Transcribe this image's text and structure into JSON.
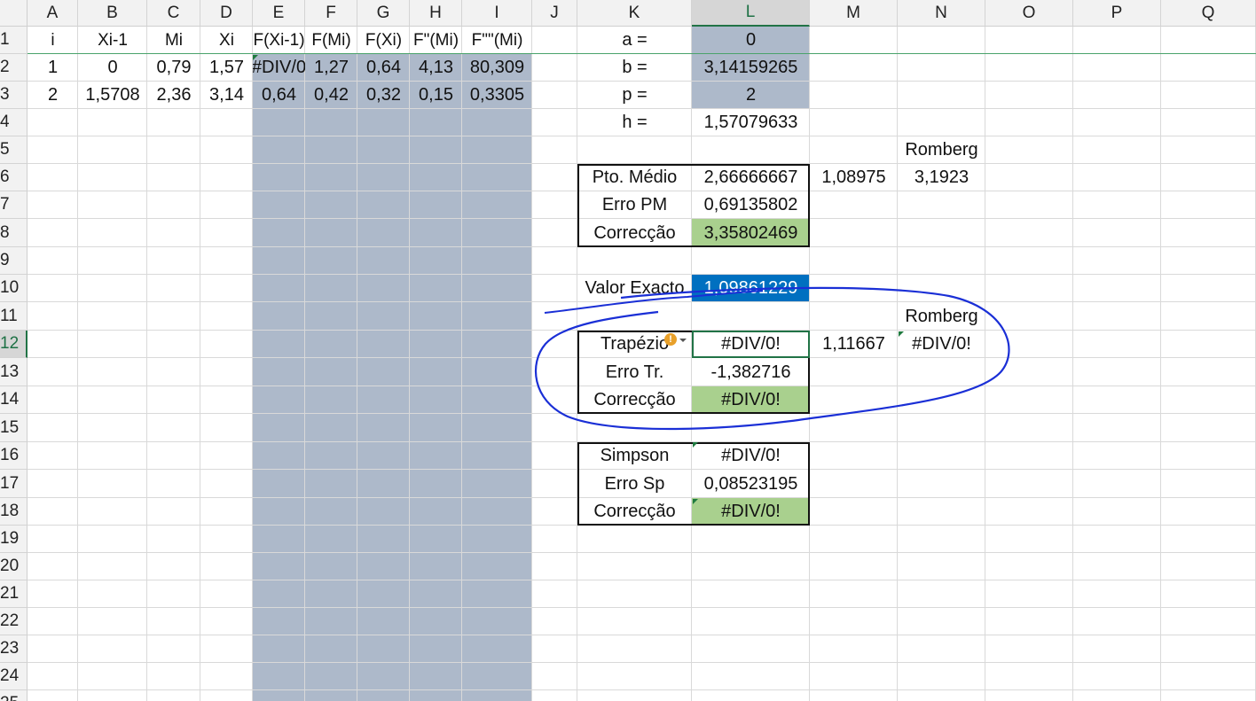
{
  "columns": [
    "A",
    "B",
    "C",
    "D",
    "E",
    "F",
    "G",
    "H",
    "I",
    "J",
    "K",
    "L",
    "M",
    "N",
    "O",
    "P",
    "Q"
  ],
  "rows": [
    "1",
    "2",
    "3",
    "4",
    "5",
    "6",
    "7",
    "8",
    "9",
    "10",
    "11",
    "12",
    "13",
    "14",
    "15",
    "16",
    "17",
    "18",
    "19",
    "20",
    "21",
    "22",
    "23",
    "24",
    "25"
  ],
  "selected_column": "L",
  "selected_row": "12",
  "header_row": [
    "i",
    "Xi-1",
    "Mi",
    "Xi",
    "F(Xi-1)",
    "F(Mi)",
    "F(Xi)",
    "F\"(Mi)",
    "F\"\"(Mi)"
  ],
  "data_rows": [
    [
      "1",
      "0",
      "0,79",
      "1,57",
      "#DIV/0",
      "1,27",
      "0,64",
      "4,13",
      "80,309"
    ],
    [
      "2",
      "1,5708",
      "2,36",
      "3,14",
      "0,64",
      "0,42",
      "0,32",
      "0,15",
      "0,3305"
    ]
  ],
  "params": [
    {
      "label": "a =",
      "value": "0"
    },
    {
      "label": "b =",
      "value": "3,14159265"
    },
    {
      "label": "p =",
      "value": "2"
    },
    {
      "label": "h =",
      "value": "1,57079633"
    }
  ],
  "romberg_label": "Romberg",
  "ponto_medio": {
    "rows": [
      {
        "label": "Pto. Médio",
        "value": "2,66666667"
      },
      {
        "label": "Erro PM",
        "value": "0,69135802"
      },
      {
        "label": "Correcção",
        "value": "3,35802469"
      }
    ],
    "m_value": "1,08975",
    "romberg_value": "3,1923"
  },
  "valor_exacto": {
    "label": "Valor Exacto",
    "value": "1,09861229"
  },
  "trapezio": {
    "rows": [
      {
        "label": "Trapézio",
        "value": "#DIV/0!"
      },
      {
        "label": "Erro Tr.",
        "value": "-1,382716"
      },
      {
        "label": "Correcção",
        "value": "#DIV/0!"
      }
    ],
    "m_value": "1,11667",
    "romberg_value": "#DIV/0!",
    "warning_glyph": "!"
  },
  "simpson": {
    "rows": [
      {
        "label": "Simpson",
        "value": "#DIV/0!"
      },
      {
        "label": "Erro Sp",
        "value": "0,08523195"
      },
      {
        "label": "Correcção",
        "value": "#DIV/0!"
      }
    ]
  },
  "colors": {
    "header_bg": "#f2f2f2",
    "input_fill": "#adb9ca",
    "correction_fill": "#a9d08e",
    "selection_blue": "#0070c0",
    "selection_green": "#217346",
    "ink_blue": "#1a2fd6"
  }
}
